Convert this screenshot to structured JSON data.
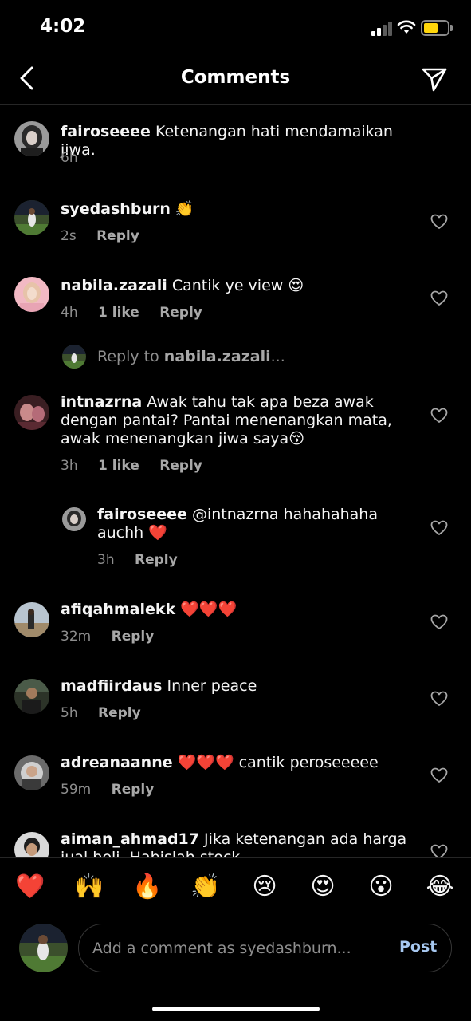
{
  "status_bar": {
    "time": "4:02"
  },
  "header": {
    "title": "Comments"
  },
  "caption": {
    "username": "fairoseeee",
    "text": "Ketenangan hati mendamaikan jiwa.",
    "time": "6h"
  },
  "comments": [
    {
      "username": "syedashburn",
      "text": "👏",
      "time": "2s",
      "likes": "",
      "reply": "Reply"
    },
    {
      "username": "nabila.zazali",
      "text": "Cantik ye view 😍",
      "time": "4h",
      "likes": "1 like",
      "reply": "Reply"
    },
    {
      "username": "intnazrna",
      "text": "Awak tahu tak apa beza awak dengan pantai? Pantai menenangkan mata, awak menenangkan jiwa saya😚",
      "time": "3h",
      "likes": "1 like",
      "reply": "Reply"
    },
    {
      "username": "fairoseeee",
      "text": "@intnazrna hahahahaha auchh ❤️",
      "time": "3h",
      "likes": "",
      "reply": "Reply"
    },
    {
      "username": "afiqahmalekk",
      "text": "❤️❤️❤️",
      "time": "32m",
      "likes": "",
      "reply": "Reply"
    },
    {
      "username": "madfiirdaus",
      "text": "Inner peace",
      "time": "5h",
      "likes": "",
      "reply": "Reply"
    },
    {
      "username": "adreanaanne",
      "text": "❤️❤️❤️ cantik peroseeeee",
      "time": "59m",
      "likes": "",
      "reply": "Reply"
    },
    {
      "username": "aiman_ahmad17",
      "text": "Jika ketenangan ada harga jual beli. Habislah stock",
      "time": "",
      "likes": "",
      "reply": ""
    }
  ],
  "reply_to": {
    "prefix": "Reply to",
    "username": "nabila.zazali",
    "suffix": "..."
  },
  "emoji_bar": [
    "❤️",
    "🙌",
    "🔥",
    "👏",
    "😢",
    "😍",
    "😮",
    "😂"
  ],
  "composer": {
    "placeholder": "Add a comment as syedashburn...",
    "post_label": "Post"
  },
  "icons": {
    "back": "back-chevron-icon",
    "share": "direct-message-icon",
    "heart": "heart-outline-icon"
  },
  "colors": {
    "background": "#000000",
    "post_accent": "#a7c8f0",
    "battery": "#ffd60a"
  }
}
